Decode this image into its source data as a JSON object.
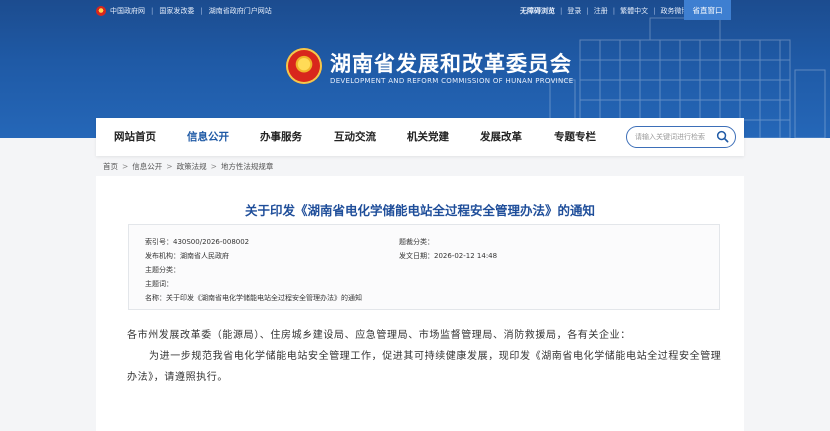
{
  "topbar": {
    "links_left": [
      "中国政府网",
      "国家发改委",
      "湖南省政府门户网站"
    ],
    "barrier_free": "无障碍浏览",
    "login": "登录",
    "register": "注册",
    "lang": "繁體中文",
    "gov_weibo": "政务微博",
    "portal": "省直窗口"
  },
  "header": {
    "title": "湖南省发展和改革委员会",
    "subtitle": "DEVELOPMENT AND REFORM COMMISSION OF HUNAN PROVINCE"
  },
  "nav": {
    "items": [
      "网站首页",
      "信息公开",
      "办事服务",
      "互动交流",
      "机关党建",
      "发展改革",
      "专题专栏"
    ],
    "active_index": 1,
    "search_placeholder": "请输入关键词进行检索"
  },
  "breadcrumb": [
    "首页",
    "信息公开",
    "政策法规",
    "地方性法规规章"
  ],
  "document": {
    "title": "关于印发《湖南省电化学储能电站全过程安全管理办法》的通知",
    "meta": {
      "index_no": "索引号：430S00/2026-008002",
      "publisher": "发布机构：湖南省人民政府",
      "topic": "主题分类：",
      "keywords": "主题词：",
      "name": "名称：关于印发《湖南省电化学储能电站全过程安全管理办法》的通知",
      "category": "题裁分类：",
      "date": "发文日期：2026-02-12 14:48"
    },
    "addressees": "各市州发展改革委（能源局）、住房城乡建设局、应急管理局、市场监督管理局、消防救援局，各有关企业：",
    "paragraph": "为进一步规范我省电化学储能电站安全管理工作，促进其可持续健康发展，现印发《湖南省电化学储能电站全过程安全管理办法》，请遵照执行。"
  },
  "colors": {
    "banner": "#1f5aa6",
    "title_blue": "#1f4e9a",
    "portal_button": "#3e7fd1"
  }
}
